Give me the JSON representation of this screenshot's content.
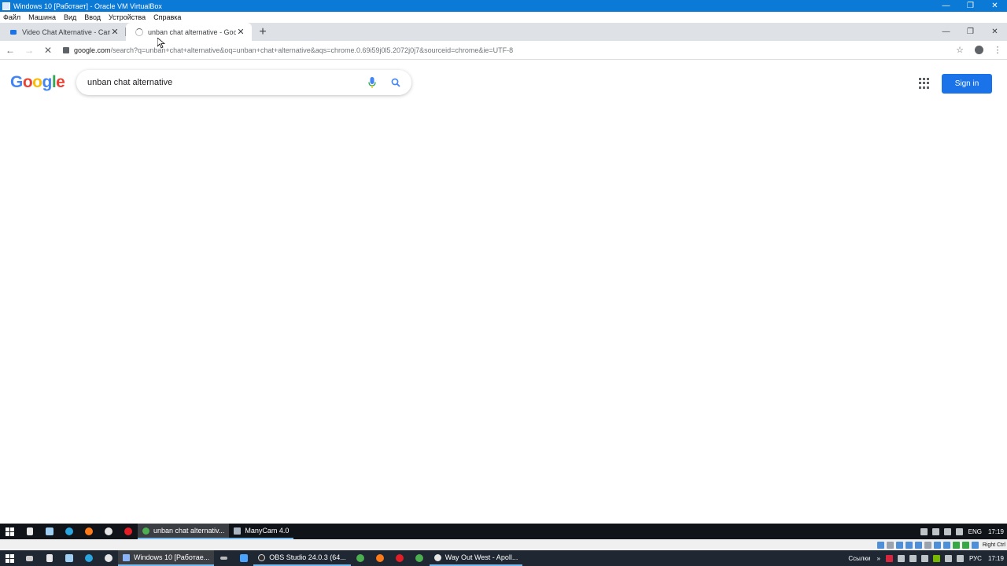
{
  "vbox": {
    "title": "Windows 10 [Работает] - Oracle VM VirtualBox",
    "menu": [
      "Файл",
      "Машина",
      "Вид",
      "Ввод",
      "Устройства",
      "Справка"
    ],
    "status": {
      "host_key": "Right Ctrl"
    }
  },
  "browser": {
    "tabs": [
      {
        "label": "Video Chat Alternative - Cam Ch",
        "icon": "camera-icon",
        "active": false
      },
      {
        "label": "unban chat alternative - Google S",
        "icon": "loading-spinner-icon",
        "active": true
      }
    ],
    "url_host": "google.com",
    "url_rest": "/search?q=unban+chat+alternative&oq=unban+chat+alternative&aqs=chrome.0.69i59j0l5.2072j0j7&sourceid=chrome&ie=UTF-8"
  },
  "page": {
    "logo_letters": [
      "G",
      "o",
      "o",
      "g",
      "l",
      "e"
    ],
    "search": {
      "value": "unban chat alternative"
    },
    "signin_label": "Sign in",
    "colors": {
      "google_blue": "#1a73e8",
      "logo_blue": "#4285f4",
      "logo_red": "#ea4335",
      "logo_yellow": "#fbbc05",
      "logo_green": "#34a853"
    }
  },
  "guest_taskbar": {
    "tasks": [
      {
        "label": "unban chat alternativ...",
        "icon": "chrome-icon",
        "active": true
      },
      {
        "label": "ManyCam 4.0",
        "icon": "manycam-icon",
        "active": false
      }
    ],
    "lang": "ENG",
    "time": "17:19"
  },
  "host_taskbar": {
    "tasks": [
      {
        "label": "Windows 10 [Работае...",
        "icon": "virtualbox-icon",
        "active": true
      },
      {
        "label": "OBS Studio 24.0.3 (64...",
        "icon": "obs-icon",
        "active": false
      },
      {
        "label": "Way Out West - Apoll...",
        "icon": "yandex-browser-icon",
        "active": false
      }
    ],
    "links_label": "Ссылки",
    "lang": "РУС",
    "time": "17:19"
  }
}
